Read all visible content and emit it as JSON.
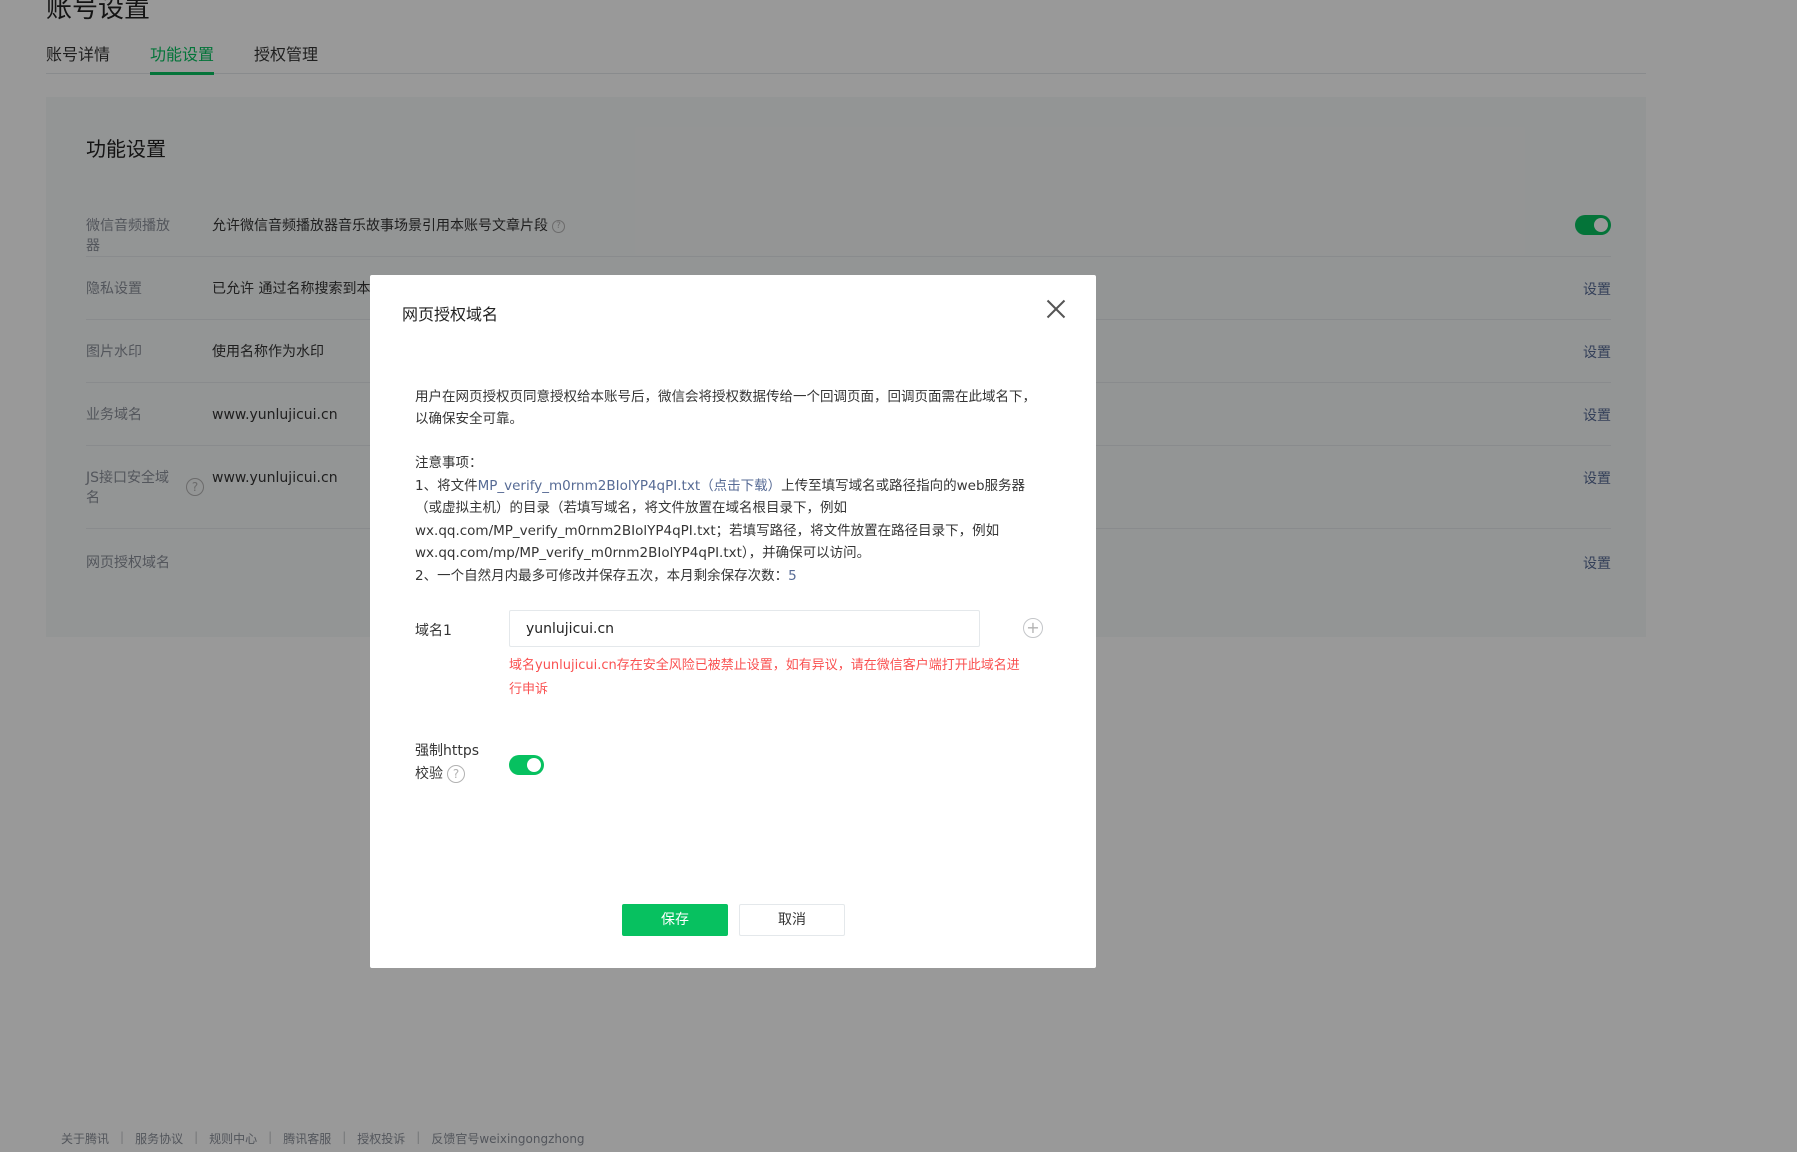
{
  "page": {
    "title": "账号设置",
    "tabs": [
      "账号详情",
      "功能设置",
      "授权管理"
    ],
    "active_tab": "功能设置"
  },
  "panel": {
    "title": "功能设置",
    "rows": [
      {
        "label": "微信音频播放器",
        "value": "允许微信音频播放器音乐故事场景引用本账号文章片段",
        "action": ""
      },
      {
        "label": "隐私设置",
        "value": "已允许 通过名称搜索到本",
        "action": "设置"
      },
      {
        "label": "图片水印",
        "value": "使用名称作为水印",
        "action": "设置"
      },
      {
        "label": "业务域名",
        "value": "www.yunlujicui.cn",
        "action": "设置"
      },
      {
        "label": "JS接口安全域名",
        "value": "www.yunlujicui.cn",
        "action": "设置"
      },
      {
        "label": "网页授权域名",
        "value": "",
        "action": "设置"
      }
    ],
    "audio_toggle_on": true
  },
  "dialog": {
    "title": "网页授权域名",
    "description": "用户在网页授权页同意授权给本账号后，微信会将授权数据传给一个回调页面，回调页面需在此域名下，以确保安全可靠。",
    "notes_title": "注意事项：",
    "note1_prefix": "1、将文件",
    "note1_link": "MP_verify_m0rnm2BIolYP4qPI.txt（点击下载）",
    "note1_suffix": "上传至填写域名或路径指向的web服务器（或虚拟主机）的目录（若填写域名，将文件放置在域名根目录下，例如wx.qq.com/MP_verify_m0rnm2BIolYP4qPI.txt；若填写路径，将文件放置在路径目录下，例如wx.qq.com/mp/MP_verify_m0rnm2BIolYP4qPI.txt），并确保可以访问。",
    "note2_prefix": "2、一个自然月内最多可修改并保存五次，本月剩余保存次数：",
    "note2_count": "5",
    "field_label": "域名1",
    "domain_value": "yunlujicui.cn",
    "error": "域名yunlujicui.cn存在安全风险已被禁止设置，如有异议，请在微信客户端打开此域名进行申诉",
    "https_label_1": "强制https",
    "https_label_2": "校验",
    "https_on": true,
    "save_label": "保存",
    "cancel_label": "取消"
  },
  "footer": [
    "关于腾讯",
    "服务协议",
    "规则中心",
    "腾讯客服",
    "授权投诉",
    "反馈官号weixingongzhong"
  ],
  "colors": {
    "accent": "#07c160",
    "link": "#576b95",
    "error": "#fa5151"
  }
}
